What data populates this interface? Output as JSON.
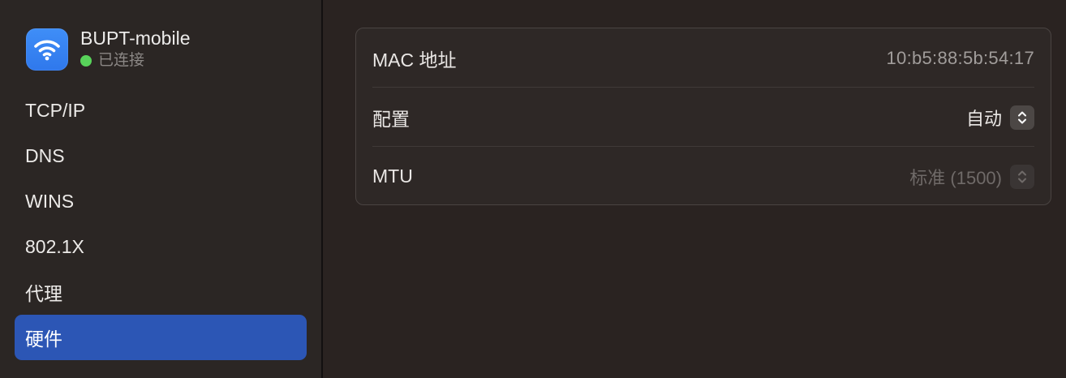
{
  "network": {
    "name": "BUPT-mobile",
    "status": "已连接",
    "status_color": "#58d35a",
    "icon": "wifi-icon"
  },
  "sidebar": {
    "items": [
      {
        "label": "TCP/IP",
        "active": false
      },
      {
        "label": "DNS",
        "active": false
      },
      {
        "label": "WINS",
        "active": false
      },
      {
        "label": "802.1X",
        "active": false
      },
      {
        "label": "代理",
        "active": false
      },
      {
        "label": "硬件",
        "active": true
      }
    ],
    "accent": "#2c56b5"
  },
  "hardware": {
    "mac_label": "MAC 地址",
    "mac_value": "10:b5:88:5b:54:17",
    "config_label": "配置",
    "config_value": "自动",
    "mtu_label": "MTU",
    "mtu_value": "标准 (1500)"
  }
}
